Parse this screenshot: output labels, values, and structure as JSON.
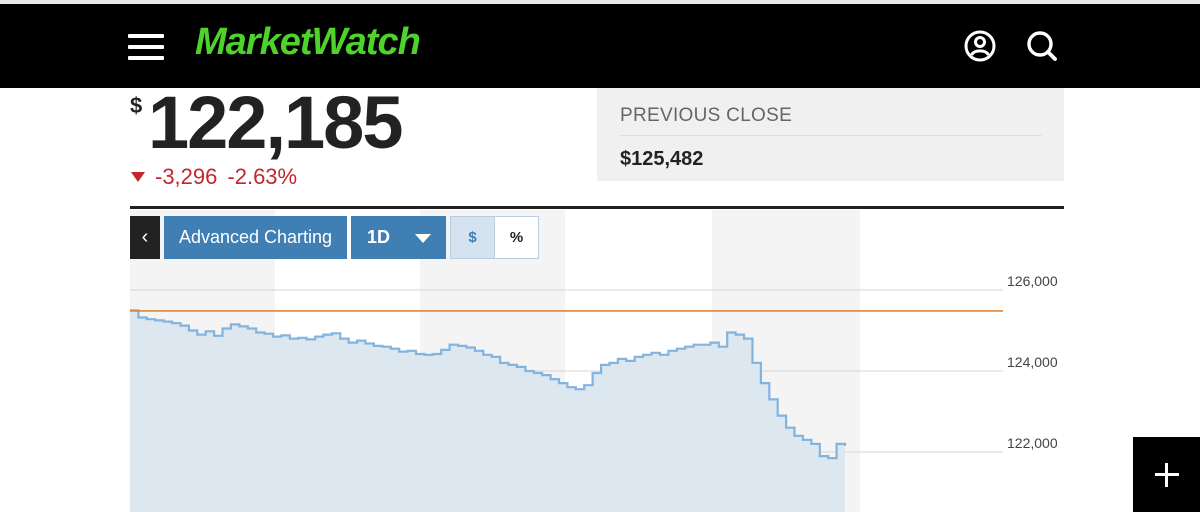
{
  "header": {
    "logo_text": "MarketWatch",
    "menu_icon": "hamburger-menu-icon",
    "user_icon": "user-account-icon",
    "search_icon": "search-icon",
    "brand_color": "#4ed32b"
  },
  "quote": {
    "currency_symbol": "$",
    "price": "122,185",
    "change": "-3,296",
    "change_percent": "-2.63%",
    "direction_icon": "down-triangle-icon",
    "negative_color": "#c1272d"
  },
  "previous_close": {
    "label": "PREVIOUS CLOSE",
    "value": "$125,482"
  },
  "toolbar": {
    "back_label": "‹",
    "advanced_charting_label": "Advanced Charting",
    "range_value": "1D",
    "toggle_dollar_label": "$",
    "toggle_percent_label": "%",
    "accent_color": "#3f7fb3"
  },
  "chart_data": {
    "type": "area",
    "y_ticks": [
      "126,000",
      "124,000",
      "122,000"
    ],
    "y_tick_values": [
      126000,
      124000,
      122000
    ],
    "previous_close_line": 125482,
    "line_color": "#82b4e0",
    "reference_color": "#e0873a",
    "series": [
      {
        "values": [
          125500,
          125320,
          125280,
          125250,
          125220,
          125180,
          125120,
          125000,
          124900,
          124980,
          124870,
          125050,
          125150,
          125100,
          125050,
          124950,
          124920,
          124850,
          124880,
          124800,
          124820,
          124780,
          124850,
          124900,
          124930,
          124800,
          124700,
          124750,
          124680,
          124620,
          124600,
          124550,
          124480,
          124500,
          124420,
          124400,
          124420,
          124520,
          124650,
          124620,
          124580,
          124500,
          124400,
          124350,
          124200,
          124150,
          124100,
          124000,
          123950,
          123900,
          123800,
          123700,
          123600,
          123550,
          123650,
          123950,
          124150,
          124200,
          124300,
          124250,
          124350,
          124400,
          124450,
          124400,
          124500,
          124550,
          124600,
          124650,
          124650,
          124700,
          124600,
          124950,
          124900,
          124800,
          124200,
          123700,
          123300,
          122900,
          122600,
          122400,
          122300,
          122200,
          121900,
          121850,
          122200,
          122150
        ]
      }
    ]
  },
  "fab": {
    "icon": "plus-icon"
  }
}
